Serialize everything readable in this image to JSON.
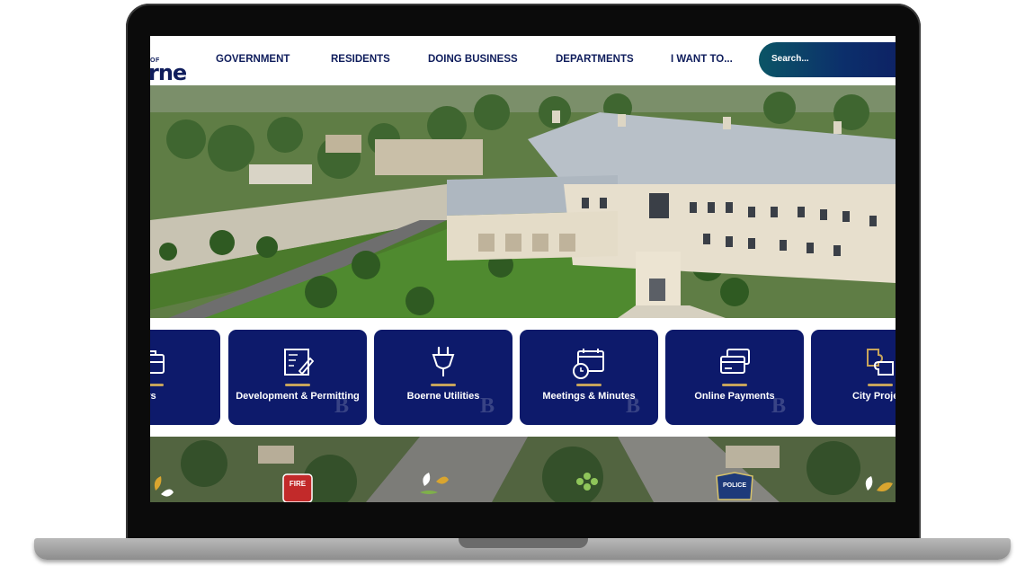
{
  "header": {
    "logo_small": "OF",
    "logo_text": "rne",
    "nav": [
      "GOVERNMENT",
      "RESIDENTS",
      "DOING BUSINESS",
      "DEPARTMENTS",
      "I WANT TO..."
    ],
    "search_placeholder": "Search..."
  },
  "cards": [
    {
      "label": "eers",
      "icon": "briefcase-icon"
    },
    {
      "label": "Development & Permitting",
      "icon": "blueprint-icon"
    },
    {
      "label": "Boerne Utilities",
      "icon": "plug-icon"
    },
    {
      "label": "Meetings & Minutes",
      "icon": "calendar-clock-icon"
    },
    {
      "label": "Online Payments",
      "icon": "credit-card-icon"
    },
    {
      "label": "City Proje",
      "icon": "puzzle-icon"
    }
  ],
  "band_badges": {
    "fire": "FIRE",
    "police": "POLICE"
  },
  "colors": {
    "navy": "#0d1a6b",
    "accent": "#c7a45b",
    "search_teal": "#0b5566"
  }
}
